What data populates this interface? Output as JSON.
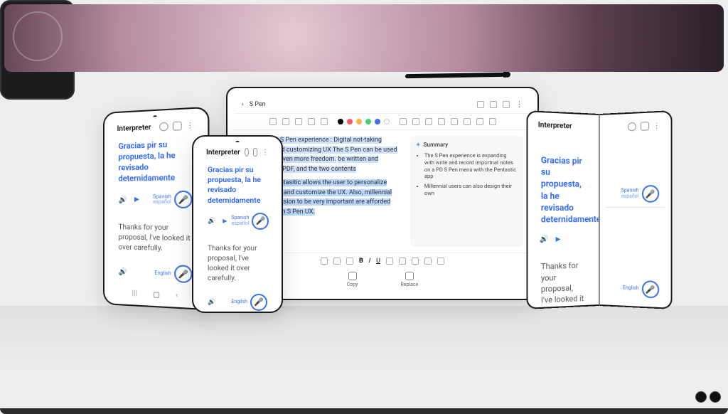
{
  "interpreter": {
    "app_title": "Interpreter",
    "translated_text": "Gracias pir su propuesta, la he revisado deternidamente",
    "original_text": "Thanks for your proposal, I've looked it over carefully.",
    "source_lang": "Spanish",
    "source_lang_sub": "español",
    "target_lang": "English"
  },
  "tablet": {
    "doc_title": "S Pen",
    "note_p1_a": "Exanding the S Pen experience : Digital not-taking experience and customizing UX The S Pen can be used on Note with even more freedom.",
    "note_p1_b": "be written and recorded on a PDF, and the two contents",
    "note_p2_a": "app called Pentasitic allows the user to personalize",
    "note_p2_b": "that they want and customize the UX. Also, millennial",
    "note_p2_c": "ersonal expression to be very important are afforded",
    "note_p2_d": "gning their own S Pen UX.",
    "summary_title": "Summary",
    "summary_items": [
      "The S Pen experience is expanding with write and record importnat notes on a PD S Pen menu with the Pentastic app",
      "Millennial users can also design their own"
    ],
    "action_copy": "Copy",
    "action_replace": "Replace",
    "pen_colors": [
      "#000000",
      "#ff5a5a",
      "#ffb04a",
      "#4ad06b",
      "#3b6fef",
      "#ffffff"
    ]
  }
}
